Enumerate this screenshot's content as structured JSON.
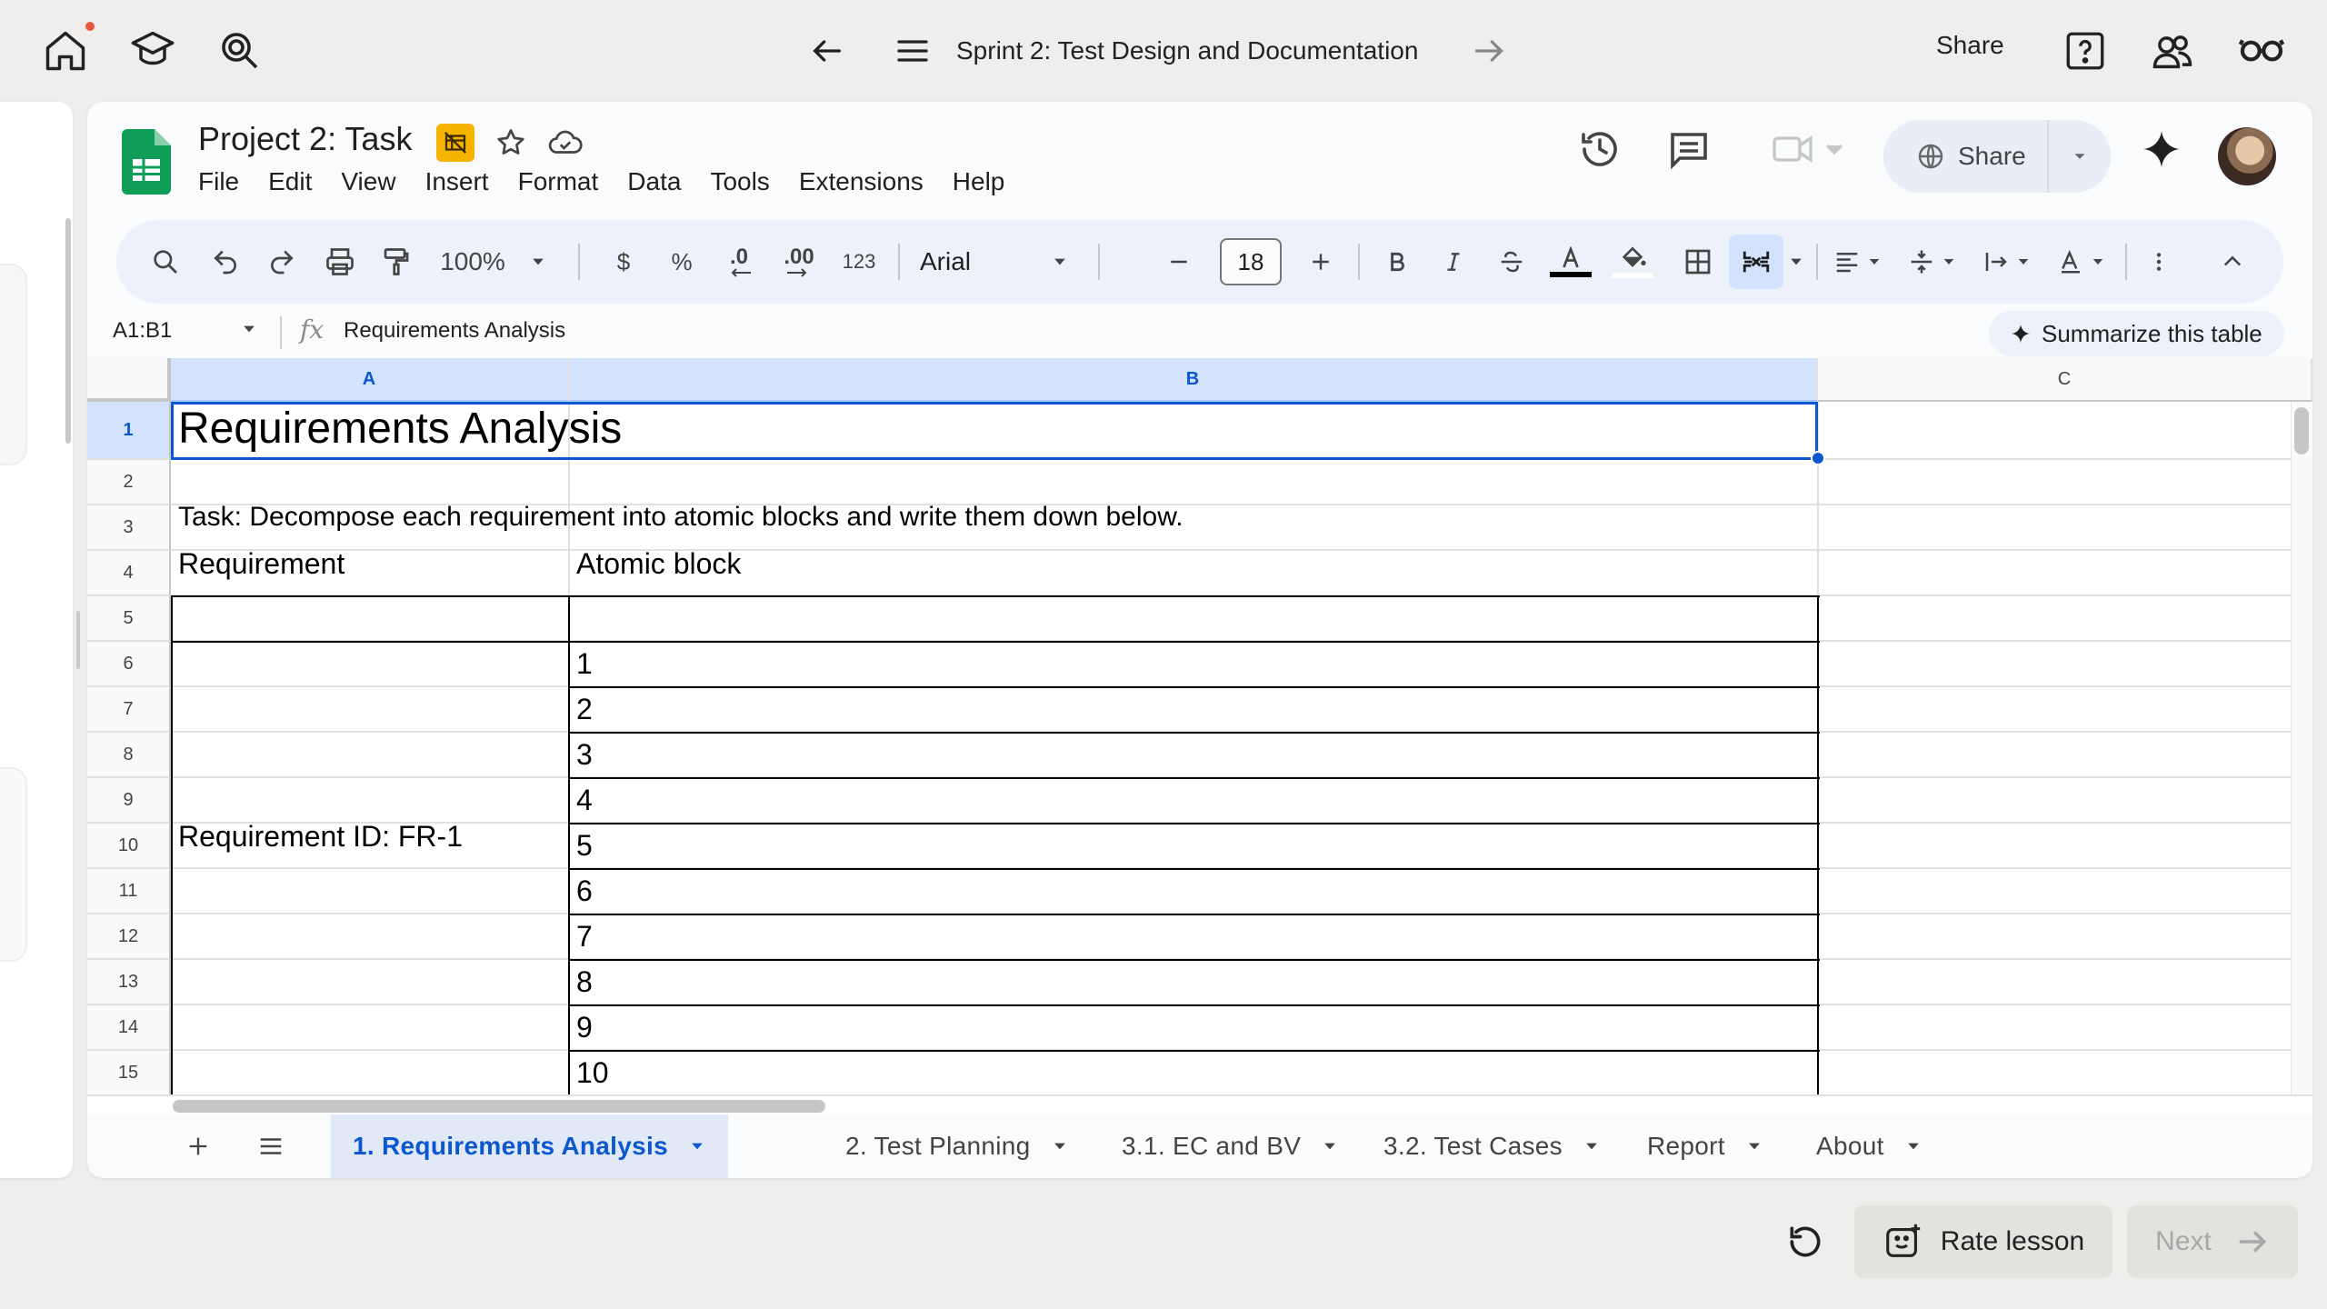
{
  "app_bar": {
    "title": "Sprint 2: Test Design and Documentation",
    "share_label": "Share"
  },
  "doc": {
    "title": "Project 2: Task",
    "menu": [
      "File",
      "Edit",
      "View",
      "Insert",
      "Format",
      "Data",
      "Tools",
      "Extensions",
      "Help"
    ],
    "share_label": "Share"
  },
  "toolbar": {
    "zoom": "100%",
    "currency": "$",
    "percent": "%",
    "dec_decrease": ".0",
    "dec_increase": ".00",
    "number_format": "123",
    "font": "Arial",
    "font_size": "18"
  },
  "formula_bar": {
    "name_box": "A1:B1",
    "fx": "fx",
    "content": "Requirements Analysis",
    "summarize": "Summarize this table"
  },
  "grid": {
    "columns": [
      "A",
      "B",
      "C"
    ],
    "rows": [
      "1",
      "2",
      "3",
      "4",
      "5",
      "6",
      "7",
      "8",
      "9",
      "10",
      "11",
      "12",
      "13",
      "14",
      "15"
    ],
    "title": "Requirements Analysis",
    "task": "Task: Decompose each requirement into atomic blocks and write them down below.",
    "header_requirement": "Requirement",
    "header_atomic": "Atomic block",
    "requirement_id": "Requirement ID: FR-1",
    "atomic_blocks": [
      "1",
      "2",
      "3",
      "4",
      "5",
      "6",
      "7",
      "8",
      "9",
      "10"
    ]
  },
  "tabs": [
    {
      "label": "1. Requirements Analysis",
      "active": true
    },
    {
      "label": "2. Test Planning",
      "active": false
    },
    {
      "label": "3.1. EC and BV",
      "active": false
    },
    {
      "label": "3.2. Test Cases",
      "active": false
    },
    {
      "label": "Report",
      "active": false
    },
    {
      "label": "About",
      "active": false
    }
  ],
  "lesson": {
    "rate_label": "Rate lesson",
    "next_label": "Next"
  },
  "colors": {
    "accent": "#0b57d0",
    "selection": "#d3e3fd",
    "sheets_green": "#0f9d58",
    "notification": "#e8553e"
  },
  "icons": {
    "app_bar": [
      "home-icon",
      "graduation-cap-icon",
      "search-icon",
      "back-arrow-icon",
      "menu-icon",
      "forward-arrow-icon",
      "help-icon",
      "community-icon",
      "glasses-icon"
    ],
    "doc_header": [
      "sheets-logo-icon",
      "slides-badge-icon",
      "star-icon",
      "cloud-icon",
      "history-icon",
      "comment-icon",
      "meet-icon",
      "globe-icon",
      "gemini-icon"
    ],
    "toolbar": [
      "search-icon",
      "undo-icon",
      "redo-icon",
      "print-icon",
      "paint-format-icon",
      "minus-icon",
      "plus-icon",
      "bold-icon",
      "italic-icon",
      "strikethrough-icon",
      "text-color-icon",
      "fill-color-icon",
      "borders-icon",
      "merge-cells-icon",
      "align-icon",
      "valign-icon",
      "text-wrap-icon",
      "text-rotate-icon",
      "more-icon",
      "collapse-icon"
    ]
  }
}
